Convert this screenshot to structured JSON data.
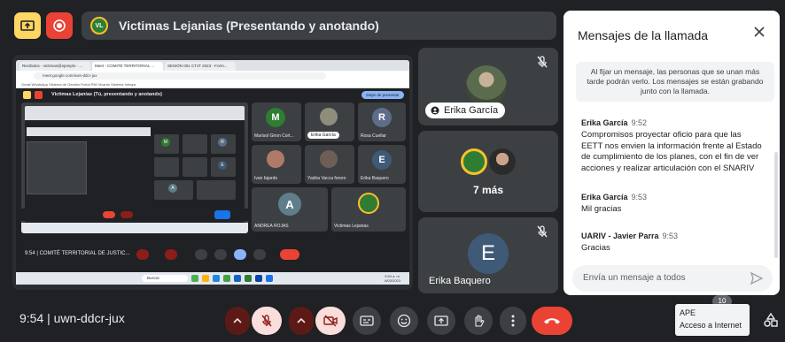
{
  "topbar": {
    "presenter_avatar_text": "VL",
    "presenter_title": "Victimas Lejanias (Presentando y anotando)"
  },
  "shared_screen": {
    "browser_tabs": [
      "Recibidos - victimas@ejemplo - ...",
      "Meet - COMITÉ TERRITORIAL ...",
      "SESIÓN 001 CTJT 2023 - Form..."
    ],
    "url": "meet.google.com/uwn-ddcr-jux",
    "bookmarks": "Gmail  WhatsApp  Sistema de Gestión  Portal RNI  Vivanto  Sistema Integra",
    "inner_title": "Victimas Lejanías (Tú, presentando y anotando)",
    "stop_presenting": "Dejar de presentar",
    "inner_tiles": [
      {
        "letter": "M",
        "label": "Marisol Giron Cort..."
      },
      {
        "letter": "",
        "label": "Erika García"
      },
      {
        "letter": "R",
        "label": "Rosa Cuellar"
      },
      {
        "letter": "",
        "label": "Ivan fajardo"
      },
      {
        "letter": "",
        "label": "Yadira Vacca forero"
      },
      {
        "letter": "E",
        "label": "Erika Baquero"
      },
      {
        "letter": "A",
        "label": "ANDREA ROJAS"
      },
      {
        "letter": "",
        "label": "Victimas Lejanias"
      }
    ],
    "inner_meeting_info": "9:54 | COMITÉ TERRITORIAL DE JUSTIC...",
    "taskbar_search": "Buscar",
    "taskbar_clock": "9:54 a. m.\n6/03/2023"
  },
  "tiles": {
    "tile1_name": "Erika García",
    "tile2_more": "7 más",
    "tile3_letter": "E",
    "tile3_name": "Erika Baquero"
  },
  "chat": {
    "title": "Mensajes de la llamada",
    "pin_note": "Al fijar un mensaje, las personas que se unan más tarde podrán verlo. Los mensajes se están grabando junto con la llamada.",
    "messages": [
      {
        "author": "Erika García",
        "time": "9:52",
        "text": "Compromisos proyectar oficio para que las EETT nos envien la información frente al Estado de cumplimiento de los planes, con el fin de ver acciones y realizar articulación con el SNARIV"
      },
      {
        "author": "Erika García",
        "time": "9:53",
        "text": "Mil gracias"
      },
      {
        "author": "UARIV - Javier Parra",
        "time": "9:53",
        "text": "Gracias"
      }
    ],
    "input_placeholder": "Envía un mensaje a todos"
  },
  "bottombar": {
    "meeting_info": "9:54  |  uwn-ddcr-jux",
    "tooltip_title": "APE",
    "tooltip_body": "Acceso a Internet",
    "badge": "10"
  },
  "colors": {
    "background": "#202124",
    "tile": "#3c4043",
    "end_call": "#ea4335",
    "present_yellow": "#fdd663",
    "muted_bg": "#f9dedc"
  }
}
